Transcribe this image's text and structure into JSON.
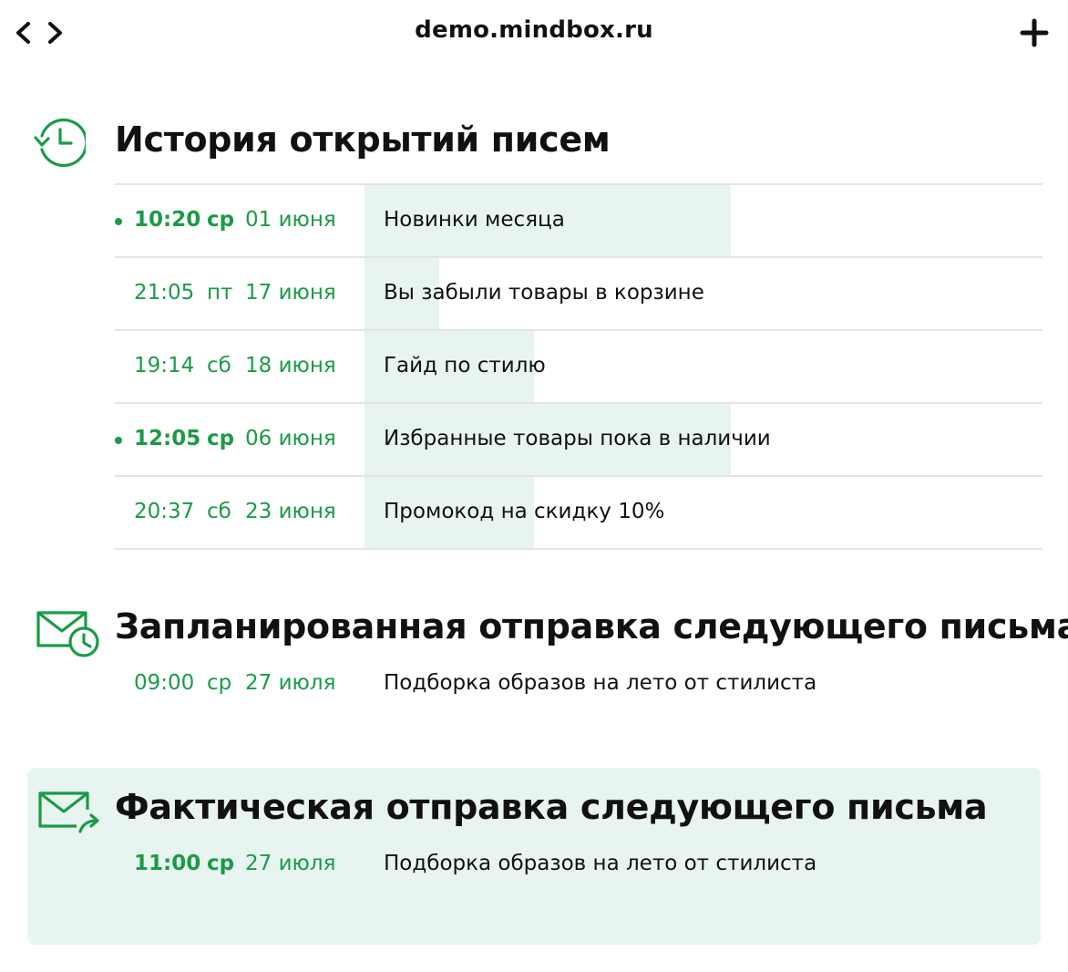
{
  "browser": {
    "url": "demo.mindbox.ru",
    "back_icon": "chevron-left-icon",
    "forward_icon": "chevron-right-icon",
    "new_tab_icon": "plus-icon"
  },
  "colors": {
    "accent": "#1a9b46",
    "highlight": "#e8f4f0",
    "divider": "#e4e4e4",
    "text": "#111111"
  },
  "history": {
    "title": "История открытий писем",
    "icon": "history-clock-icon",
    "rows": [
      {
        "time": "10:20",
        "day": "ср",
        "date": "01 июня",
        "subject": "Новинки месяца",
        "highlighted": true,
        "open_rate": 0.54
      },
      {
        "time": "21:05",
        "day": "пт",
        "date": "17 июня",
        "subject": "Вы забыли товары в корзине",
        "highlighted": false,
        "open_rate": 0.11
      },
      {
        "time": "19:14",
        "day": "сб",
        "date": "18 июня",
        "subject": "Гайд по стилю",
        "highlighted": false,
        "open_rate": 0.25
      },
      {
        "time": "12:05",
        "day": "ср",
        "date": "06 июня",
        "subject": "Избранные товары пока в наличии",
        "highlighted": true,
        "open_rate": 0.54
      },
      {
        "time": "20:37",
        "day": "сб",
        "date": "23 июня",
        "subject": "Промокод на скидку 10%",
        "highlighted": false,
        "open_rate": 0.25
      }
    ]
  },
  "scheduled": {
    "title": "Запланированная отправка следующего письма",
    "icon": "mail-clock-icon",
    "time": "09:00",
    "day": "ср",
    "date": "27 июля",
    "subject": "Подборка образов на лето от стилиста"
  },
  "actual": {
    "title": "Фактическая отправка следующего письма",
    "icon": "mail-send-icon",
    "time": "11:00",
    "day": "ср",
    "date": "27 июля",
    "subject": "Подборка образов на лето от стилиста"
  }
}
